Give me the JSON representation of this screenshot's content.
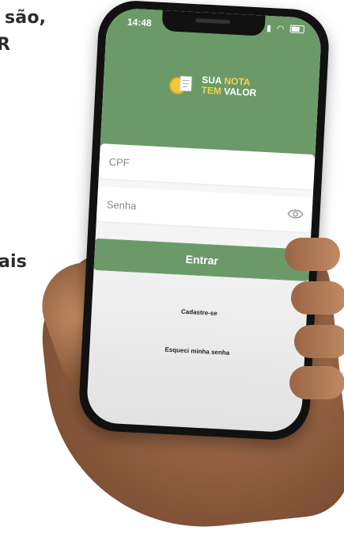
{
  "background_text": {
    "line1": "são,",
    "line2": "R",
    "line3": "ais"
  },
  "status_bar": {
    "time": "14:48",
    "icons": [
      "signal-icon",
      "wifi-icon",
      "battery-icon"
    ]
  },
  "logo": {
    "word1": "SUA",
    "word2": "NOTA",
    "word3": "TEM",
    "word4": "VALOR"
  },
  "form": {
    "cpf_placeholder": "CPF",
    "senha_placeholder": "Senha",
    "submit_label": "Entrar"
  },
  "links": {
    "register": "Cadastre-se",
    "forgot": "Esqueci minha senha"
  },
  "colors": {
    "brand_green": "#6b9a68",
    "logo_yellow": "#f4d34c"
  }
}
